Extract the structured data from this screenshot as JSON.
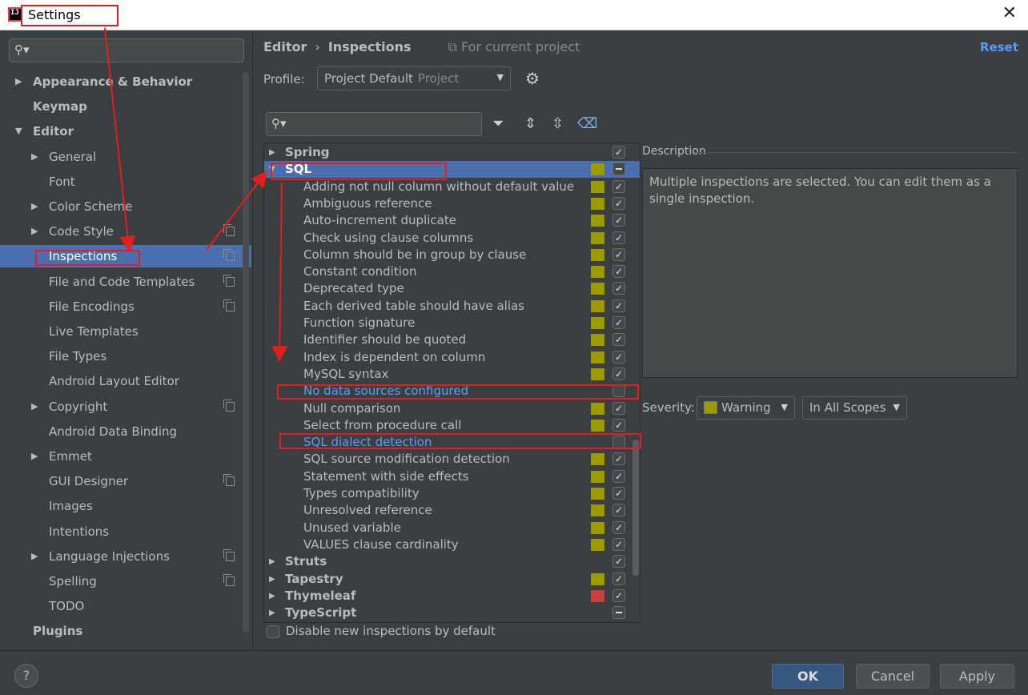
{
  "window": {
    "title": "Settings",
    "close_glyph": "✕"
  },
  "sidebar": {
    "search_placeholder": "",
    "items": [
      {
        "label": "Appearance & Behavior",
        "bold": true,
        "expand": "right"
      },
      {
        "label": "Keymap",
        "bold": true
      },
      {
        "label": "Editor",
        "bold": true,
        "expand": "down"
      },
      {
        "label": "General",
        "expand": "right"
      },
      {
        "label": "Font"
      },
      {
        "label": "Color Scheme",
        "expand": "right"
      },
      {
        "label": "Code Style",
        "expand": "right",
        "copy": true
      },
      {
        "label": "Inspections",
        "selected": true,
        "copy": true
      },
      {
        "label": "File and Code Templates",
        "copy": true
      },
      {
        "label": "File Encodings",
        "copy": true
      },
      {
        "label": "Live Templates"
      },
      {
        "label": "File Types"
      },
      {
        "label": "Android Layout Editor"
      },
      {
        "label": "Copyright",
        "expand": "right",
        "copy": true
      },
      {
        "label": "Android Data Binding"
      },
      {
        "label": "Emmet",
        "expand": "right"
      },
      {
        "label": "GUI Designer",
        "copy": true
      },
      {
        "label": "Images"
      },
      {
        "label": "Intentions"
      },
      {
        "label": "Language Injections",
        "expand": "right",
        "copy": true
      },
      {
        "label": "Spelling",
        "copy": true
      },
      {
        "label": "TODO"
      },
      {
        "label": "Plugins",
        "bold": true
      }
    ]
  },
  "header": {
    "crumb_1": "Editor",
    "crumb_sep": "›",
    "crumb_2": "Inspections",
    "scope_note": "⧉ For current project",
    "reset": "Reset"
  },
  "profile": {
    "label": "Profile:",
    "value": "Project Default",
    "sub": "Project"
  },
  "inspections": {
    "rows": [
      {
        "label": "Spring",
        "group": true,
        "expand": "right",
        "check": "checked"
      },
      {
        "label": "SQL",
        "group": true,
        "expand": "down",
        "selected": true,
        "sev": "warning",
        "check": "minus"
      },
      {
        "label": "Adding not null column without default value",
        "sev": "warning",
        "check": "checked"
      },
      {
        "label": "Ambiguous reference",
        "sev": "warning",
        "check": "checked"
      },
      {
        "label": "Auto-increment duplicate",
        "sev": "warning",
        "check": "checked"
      },
      {
        "label": "Check using clause columns",
        "sev": "warning",
        "check": "checked"
      },
      {
        "label": "Column should be in group by clause",
        "sev": "warning",
        "check": "checked"
      },
      {
        "label": "Constant condition",
        "sev": "warning",
        "check": "checked"
      },
      {
        "label": "Deprecated type",
        "sev": "warning",
        "check": "checked"
      },
      {
        "label": "Each derived table should have alias",
        "sev": "warning",
        "check": "checked"
      },
      {
        "label": "Function signature",
        "sev": "warning",
        "check": "checked"
      },
      {
        "label": "Identifier should be quoted",
        "sev": "warning",
        "check": "checked"
      },
      {
        "label": "Index is dependent on column",
        "sev": "warning",
        "check": "checked"
      },
      {
        "label": "MySQL syntax",
        "sev": "warning",
        "check": "checked"
      },
      {
        "label": "No data sources configured",
        "link": true,
        "check": "unchecked"
      },
      {
        "label": "Null comparison",
        "sev": "warning",
        "check": "checked"
      },
      {
        "label": "Select from procedure call",
        "sev": "warning",
        "check": "checked"
      },
      {
        "label": "SQL dialect detection",
        "link": true,
        "check": "unchecked"
      },
      {
        "label": "SQL source modification detection",
        "sev": "warning",
        "check": "checked"
      },
      {
        "label": "Statement with side effects",
        "sev": "warning",
        "check": "checked"
      },
      {
        "label": "Types compatibility",
        "sev": "warning",
        "check": "checked"
      },
      {
        "label": "Unresolved reference",
        "sev": "warning",
        "check": "checked"
      },
      {
        "label": "Unused variable",
        "sev": "warning",
        "check": "checked"
      },
      {
        "label": "VALUES clause cardinality",
        "sev": "warning",
        "check": "checked"
      },
      {
        "label": "Struts",
        "group": true,
        "expand": "right",
        "check": "checked"
      },
      {
        "label": "Tapestry",
        "group": true,
        "expand": "right",
        "sev": "warning",
        "check": "checked"
      },
      {
        "label": "Thymeleaf",
        "group": true,
        "expand": "right",
        "sev": "error",
        "check": "checked"
      },
      {
        "label": "TypeScript",
        "group": true,
        "expand": "right",
        "check": "minus"
      }
    ],
    "disable_new_label": "Disable new inspections by default"
  },
  "description": {
    "title": "Description",
    "text": "Multiple inspections are selected. You can edit them as a single inspection."
  },
  "severity": {
    "label": "Severity:",
    "value": "Warning",
    "scope": "In All Scopes"
  },
  "buttons": {
    "help": "?",
    "ok": "OK",
    "cancel": "Cancel",
    "apply": "Apply"
  },
  "colors": {
    "warning": "#9b9b00",
    "error": "#c94040",
    "selection": "#4b6eaf",
    "link": "#589df6",
    "annotation": "#e02020"
  }
}
